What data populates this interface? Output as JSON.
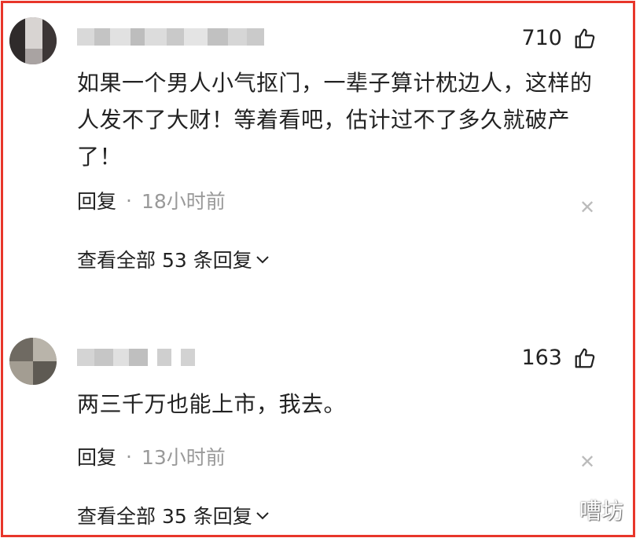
{
  "comments": [
    {
      "likes": "710",
      "text": "如果一个男人小气抠门，一辈子算计枕边人，这样的人发不了大财！等着看吧，估计过不了多久就破产了！",
      "reply_label": "回复",
      "separator": "·",
      "time": "18小时前",
      "expand_label": "查看全部 53 条回复"
    },
    {
      "likes": "163",
      "text": "两三千万也能上市，我去。",
      "reply_label": "回复",
      "separator": "·",
      "time": "13小时前",
      "expand_label": "查看全部 35 条回复"
    }
  ],
  "watermark": "嘈坊",
  "colors": {
    "frame": "#e8362a",
    "text": "#222222",
    "muted": "#999999"
  },
  "icons": {
    "like": "thumbs-up-icon",
    "close": "close-icon",
    "expand": "chevron-down-icon"
  }
}
